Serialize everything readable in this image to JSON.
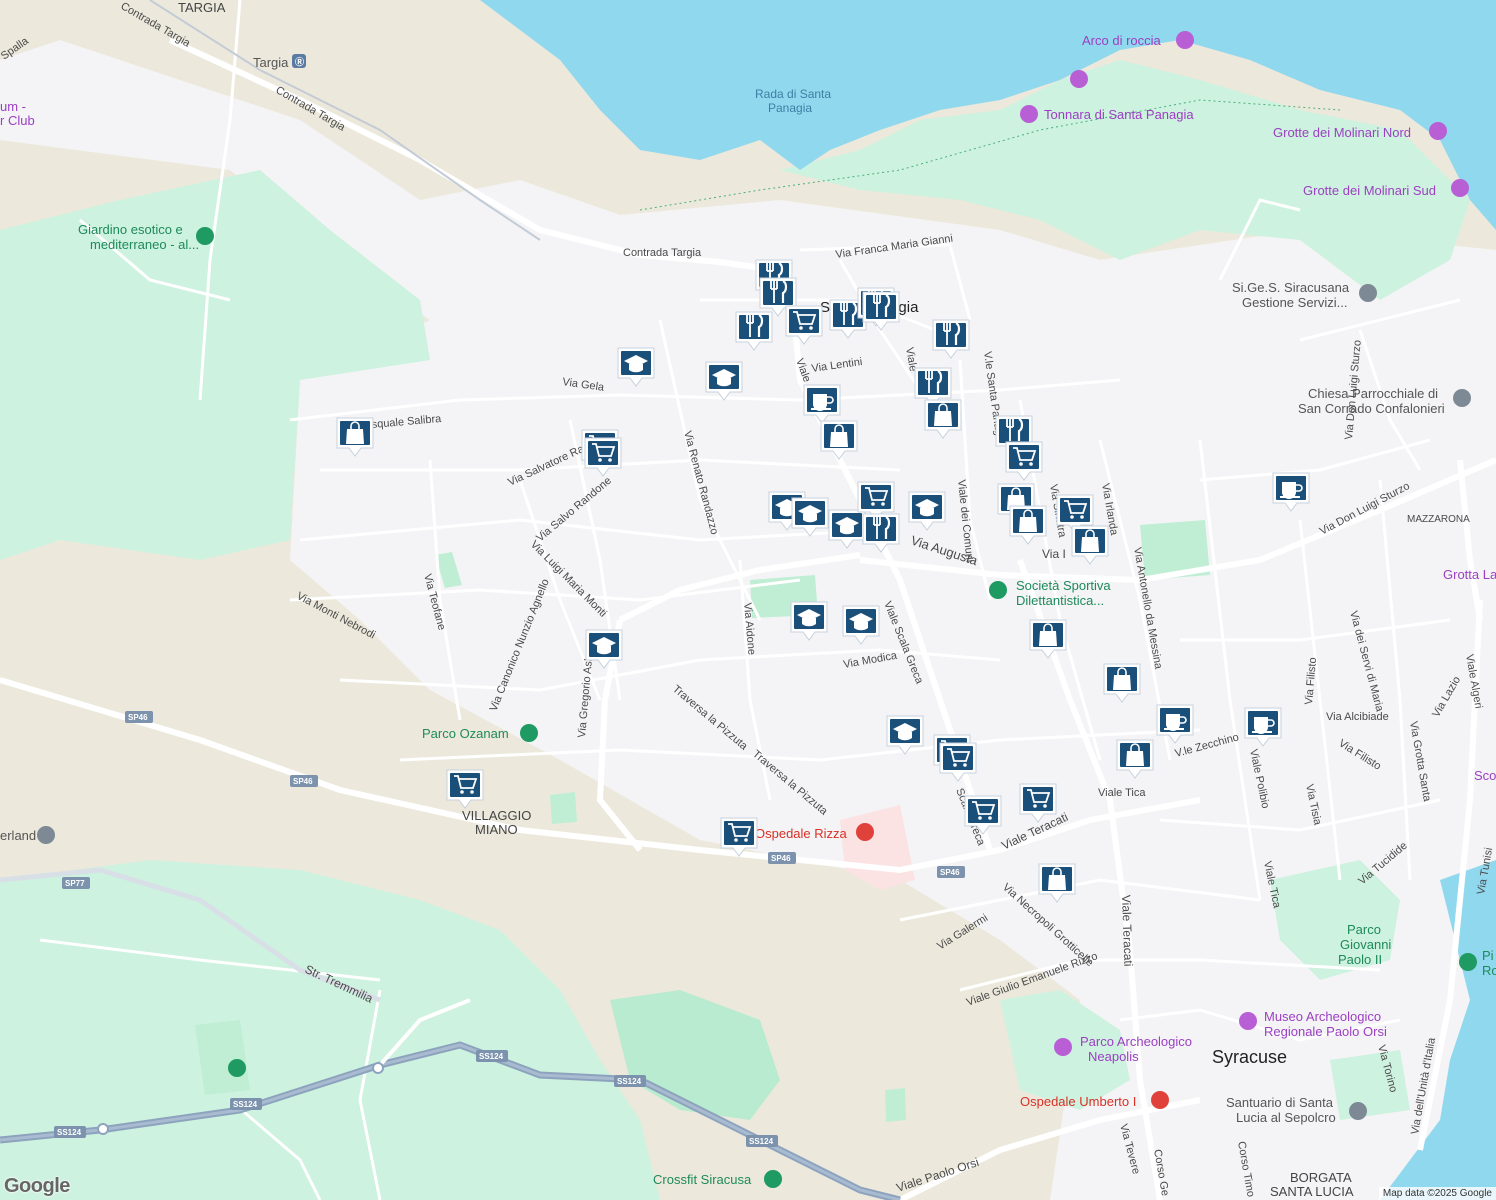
{
  "map": {
    "attribution": "Map data ©2025 Google",
    "logo": "Google",
    "colors": {
      "water": "#8fd8ee",
      "park": "#cdf2df",
      "sand": "#ece9dc",
      "road": "#ffffff",
      "highway": "#8da3bd",
      "marker": "#1a4f7a"
    },
    "places": {
      "targia": "TARGIA",
      "targia_station": "Targia",
      "santa_panagia": "Santa Panagia",
      "villaggio_miano_1": "VILLAGGIO",
      "villaggio_miano_2": "MIANO",
      "syracuse": "Syracuse",
      "mazzarona": "MAZZARONA",
      "borgata_1": "BORGATA",
      "borgata_2": "SANTA LUCIA"
    },
    "water_labels": {
      "rada_1": "Rada di Santa",
      "rada_2": "Panagia"
    },
    "pois": {
      "arco": "Arco di roccia",
      "tonnara": "Tonnara di Santa Panagia",
      "grotte_nord": "Grotte dei Molinari Nord",
      "grotte_sud": "Grotte dei Molinari Sud",
      "giardino_1": "Giardino esotico e",
      "giardino_2": "mediterraneo - al...",
      "sige_1": "Si.Ge.S. Siracusana",
      "sige_2": "Gestione Servizi...",
      "chiesa_1": "Chiesa Parrocchiale di",
      "chiesa_2": "San Corrado Confalonieri",
      "societa_1": "Società Sportiva",
      "societa_2": "Dilettantistica...",
      "parco_ozanam": "Parco Ozanam",
      "ospedale_rizza": "Ospedale Rizza",
      "parco_neapolis_1": "Parco Archeologico",
      "parco_neapolis_2": "Neapolis",
      "museo_1": "Museo Archeologico",
      "museo_2": "Regionale Paolo Orsi",
      "ospedale_umberto": "Ospedale Umberto I",
      "santuario_1": "Santuario di Santa",
      "santuario_2": "Lucia al Sepolcro",
      "parco_giovanni_1": "Parco",
      "parco_giovanni_2": "Giovanni",
      "parco_giovanni_3": "Paolo II",
      "crossfit": "Crossfit Siracusa",
      "grotta_la": "Grotta La",
      "um_club_1": "um -",
      "um_club_2": "r Club",
      "erland": "erland",
      "pi_1": "Pi",
      "pi_2": "Ro",
      "sco": "Sco"
    },
    "roads": {
      "spalla": "Spalla",
      "contrada_targia_1": "Contrada Targia",
      "contrada_targia_2": "Contrada Targia",
      "franca_maria_gianni": "Via Franca Maria Gianni",
      "via_lentini": "Via Lentini",
      "via_gela": "Via Gela",
      "pasquale_salibra": "squale Salibra",
      "salvatore": "Via Salvatore Ra",
      "salvo_randone": "Via Salvo Randone",
      "luigi_maria_monti": "Via Luigi Maria Monti",
      "renato_randazzo": "Via Renato Randazzo",
      "teofane": "Via Teofane",
      "monti_nebrodi": "Via Monti Nebrodi",
      "canonico": "Via Canonico Nunzio Agnello",
      "gregorio": "Via Gregorio Asba",
      "aidone": "Via Aidone",
      "modica": "Via Modica",
      "scala_greca": "Viale Scala Greca",
      "scala_greca_2": "Scala Greca",
      "traversa_1": "Traversa la Pizzuta",
      "traversa_2": "Traversa la Pizzuta",
      "via_augusta": "Via Augusta",
      "viale_dei_comuni": "Viale dei Comuni",
      "santa_panagia_road": "V.le Santa Panag",
      "viale_short": "Viale",
      "viale_short_2": "Viale",
      "via_sinatra": "Via Sinatra",
      "via_irlanda": "Via Irlanda",
      "via_i": "Via I",
      "antonello": "Via Antonello da Messina",
      "don_luigi_sturzo": "Via Don Luigi Sturzo",
      "viale_teracati": "Viale Teracati",
      "viale_teracati_2": "Viale Teracati",
      "viale_tica": "Viale Tica",
      "viale_tica_2": "Viale Tica",
      "zecchino": "V.le Zecchino",
      "polibio": "Viale Polibio",
      "alcibiade": "Via Alcibiade",
      "filisto": "Via Filisto",
      "filisto_2": "Via Filisto",
      "servi_maria": "Via dei Servi di Maria",
      "lazio": "Via Lazio",
      "algeri": "Viale Algeri",
      "grotta_santa": "Via Grotta Santa",
      "tisia": "Via Tisia",
      "tucidide": "Via Tucidide",
      "tunisi": "Via Tunisi",
      "necropoli": "Via Necropoli Grotticelle",
      "galermi": "Via Galermi",
      "giulio_rizzo": "Viale Giulio Emanuele Rizzo",
      "tremmilia": "Str. Tremmilia",
      "paolo_orsi": "Viale Paolo Orsi",
      "unita_italia": "Via dell'Unità d'Italia",
      "via_torino": "Via Torino",
      "via_tevere": "Via Tevere",
      "corso_ge": "Corso Ge",
      "corso_timo": "Corso Timo"
    },
    "shields": {
      "sp46_a": "SP46",
      "sp46_b": "SP46",
      "sp46_c": "SP46",
      "sp46_d": "SP46",
      "sp77": "SP77",
      "ss124_a": "SS124",
      "ss124_b": "SS124",
      "ss124_c": "SS124",
      "ss124_d": "SS124",
      "ss124_e": "SS124"
    }
  }
}
